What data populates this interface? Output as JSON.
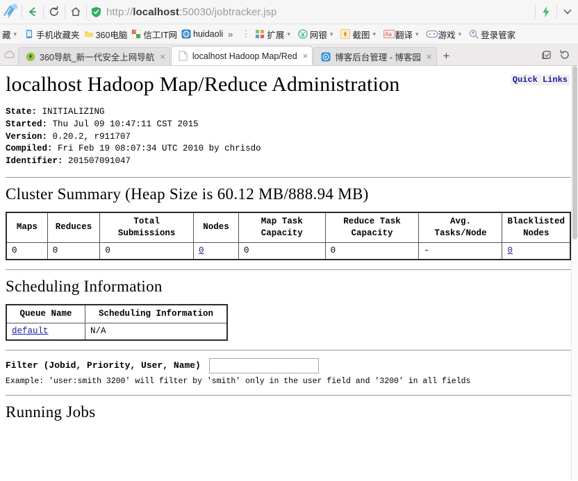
{
  "browser": {
    "nav": {
      "back_label": "←",
      "reload_label": "↻",
      "home_label": "⌂",
      "url_prefix": "http://",
      "url_host": "localhost",
      "url_rest": ":50030/jobtracker.jsp",
      "url_full": "http://localhost:50030/jobtracker.jsp",
      "lightning_label": "⚡",
      "chevron_label": "⌄"
    },
    "bookmarks": [
      {
        "label": "藏",
        "icon": "folder-icon",
        "caret": true,
        "color": "#f2c14e"
      },
      {
        "label": "手机收藏夹",
        "icon": "phone-icon",
        "caret": false,
        "color": "#4a90d9"
      },
      {
        "label": "360电脑",
        "icon": "folder-icon",
        "caret": false,
        "color": "#f5c242"
      },
      {
        "label": "信工IT网",
        "icon": "site-icon",
        "caret": false,
        "color": "#e05a3b"
      },
      {
        "label": "huidaoli",
        "icon": "globe-icon",
        "caret": false,
        "color": "#2a7fd4"
      }
    ],
    "bookmarks_overflow": "»",
    "toolbar_buttons": [
      {
        "label": "扩展",
        "icon": "extensions-icon",
        "caret": true,
        "color": "#7cc576"
      },
      {
        "label": "网银",
        "icon": "bank-icon",
        "caret": true,
        "color": "#3cb878"
      },
      {
        "label": "截图",
        "icon": "screenshot-icon",
        "caret": true,
        "color": "#f7b733"
      },
      {
        "label": "翻译",
        "icon": "translate-icon",
        "caret": true,
        "color": "#e8554e"
      },
      {
        "label": "游戏",
        "icon": "game-icon",
        "caret": true,
        "color": "#5b8def"
      },
      {
        "label": "登录管家",
        "icon": "login-manager-icon",
        "caret": false,
        "color": "#7a8fa6"
      }
    ],
    "tabs": [
      {
        "title": "360导航_新一代安全上网导航",
        "icon": "360-icon",
        "active": false,
        "close": "×"
      },
      {
        "title": "localhost Hadoop Map/Red",
        "icon": "page-icon",
        "active": true,
        "close": "×"
      },
      {
        "title": "博客后台管理 - 博客园",
        "icon": "cnblogs-icon",
        "active": false,
        "close": "×"
      }
    ],
    "new_tab_label": "+",
    "tab_right_buttons": [
      {
        "name": "restore-tab-icon",
        "label": "⎋"
      },
      {
        "name": "history-icon",
        "label": "↺"
      }
    ]
  },
  "page": {
    "quick_links": "Quick Links",
    "title": "localhost Hadoop Map/Reduce Administration",
    "info": [
      {
        "label": "State:",
        "value": "INITIALIZING"
      },
      {
        "label": "Started:",
        "value": "Thu Jul 09 10:47:11 CST 2015"
      },
      {
        "label": "Version:",
        "value": "0.20.2, r911707"
      },
      {
        "label": "Compiled:",
        "value": "Fri Feb 19 08:07:34 UTC 2010 by chrisdo"
      },
      {
        "label": "Identifier:",
        "value": "201507091047"
      }
    ],
    "cluster_summary": {
      "heading": "Cluster Summary (Heap Size is 60.12 MB/888.94 MB)",
      "columns": [
        "Maps",
        "Reduces",
        "Total Submissions",
        "Nodes",
        "Map Task Capacity",
        "Reduce Task Capacity",
        "Avg. Tasks/Node",
        "Blacklisted Nodes"
      ],
      "row": [
        {
          "value": "0",
          "link": false
        },
        {
          "value": "0",
          "link": false
        },
        {
          "value": "0",
          "link": false
        },
        {
          "value": "0",
          "link": true
        },
        {
          "value": "0",
          "link": false
        },
        {
          "value": "0",
          "link": false
        },
        {
          "value": "-",
          "link": false
        },
        {
          "value": "0",
          "link": true
        }
      ]
    },
    "scheduling": {
      "heading": "Scheduling Information",
      "columns": [
        "Queue Name",
        "Scheduling Information"
      ],
      "rows": [
        {
          "queue": "default",
          "queue_link": true,
          "info": "N/A"
        }
      ]
    },
    "filter": {
      "label": "Filter (Jobid, Priority, User, Name)",
      "value": "",
      "placeholder": "",
      "example": "Example: 'user:smith 3200' will filter by 'smith' only in the user field and '3200' in all fields"
    },
    "running_jobs": {
      "heading": "Running Jobs"
    }
  }
}
